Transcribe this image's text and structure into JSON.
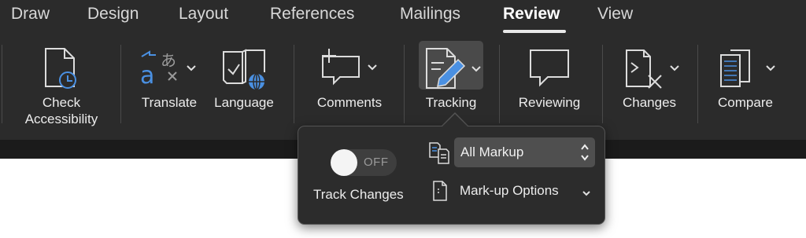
{
  "tabs": [
    {
      "label": "Draw"
    },
    {
      "label": "Design"
    },
    {
      "label": "Layout"
    },
    {
      "label": "References"
    },
    {
      "label": "Mailings"
    },
    {
      "label": "Review"
    },
    {
      "label": "View"
    }
  ],
  "active_tab": "Review",
  "ribbon": {
    "check_accessibility": {
      "line1": "Check",
      "line2": "Accessibility"
    },
    "translate": "Translate",
    "language": "Language",
    "comments": "Comments",
    "tracking": "Tracking",
    "reviewing": "Reviewing",
    "changes": "Changes",
    "compare": "Compare"
  },
  "tracking_popover": {
    "track_changes_toggle_state": "OFF",
    "track_changes_label": "Track Changes",
    "markup_select_value": "All Markup",
    "markup_options_label": "Mark-up Options"
  },
  "icons": {
    "check_accessibility": "accessibility-icon",
    "translate": "translate-icon",
    "language": "language-icon",
    "comments": "new-comment-icon",
    "tracking": "track-changes-icon",
    "reviewing": "reviewing-pane-icon",
    "changes": "changes-icon",
    "compare": "compare-icon",
    "markup_display": "markup-display-icon",
    "markup_options": "markup-options-icon"
  },
  "colors": {
    "ribbon_bg": "#2b2b2b",
    "active_tab_text": "#ffffff",
    "globe_blue": "#4a90e2",
    "translate_blue": "#4a90e2"
  }
}
